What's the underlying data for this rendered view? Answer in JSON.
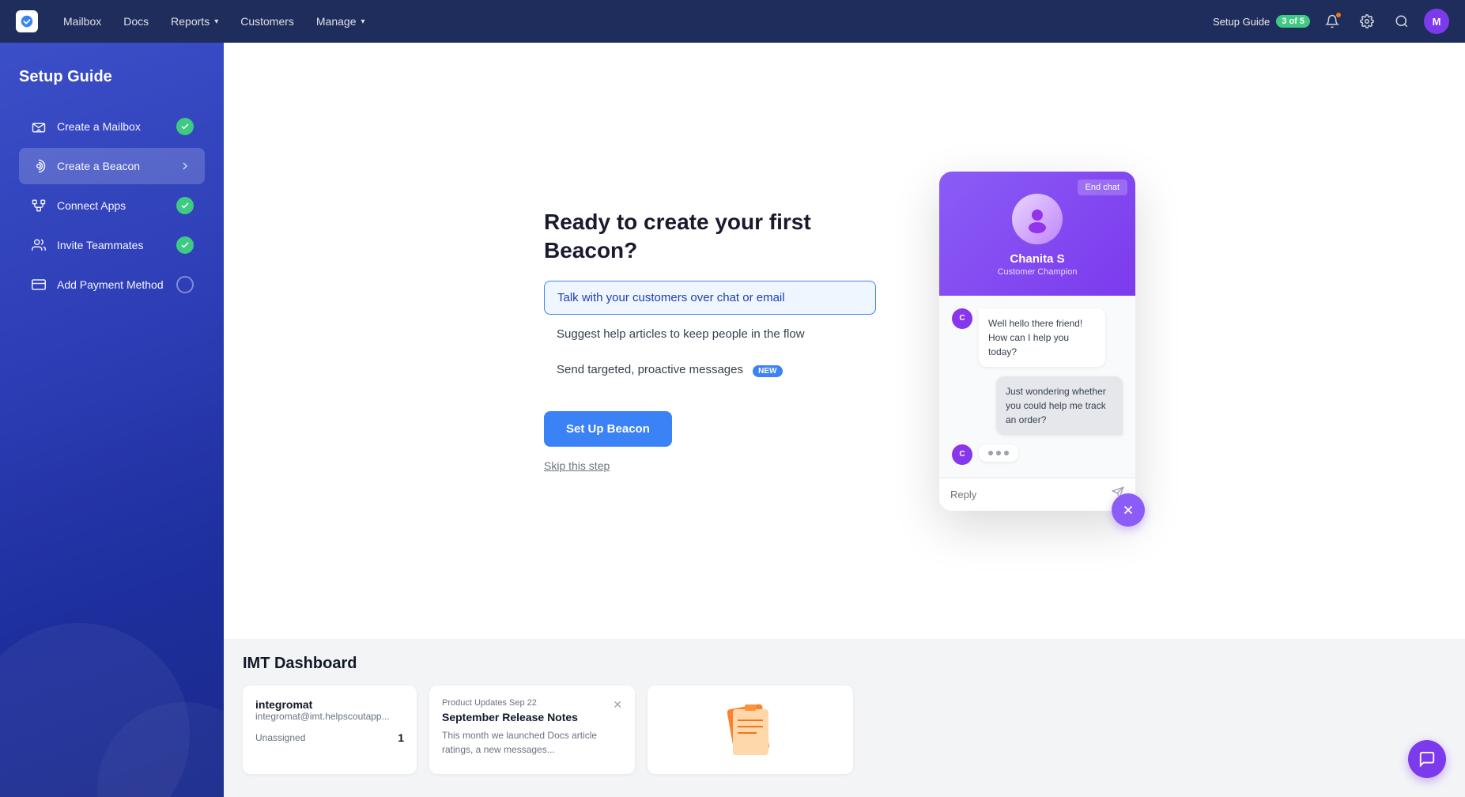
{
  "topnav": {
    "links": [
      {
        "label": "Mailbox",
        "id": "mailbox"
      },
      {
        "label": "Docs",
        "id": "docs"
      },
      {
        "label": "Reports",
        "id": "reports",
        "has_dropdown": true
      },
      {
        "label": "Customers",
        "id": "customers"
      },
      {
        "label": "Manage",
        "id": "manage",
        "has_dropdown": true
      }
    ],
    "setup_guide_label": "Setup Guide",
    "setup_guide_count": "3 of 5",
    "user_initials": "M"
  },
  "sidebar": {
    "title": "Setup Guide",
    "items": [
      {
        "id": "create-mailbox",
        "label": "Create a Mailbox",
        "status": "done"
      },
      {
        "id": "create-beacon",
        "label": "Create a Beacon",
        "status": "active"
      },
      {
        "id": "connect-apps",
        "label": "Connect Apps",
        "status": "done"
      },
      {
        "id": "invite-teammates",
        "label": "Invite Teammates",
        "status": "done"
      },
      {
        "id": "add-payment",
        "label": "Add Payment Method",
        "status": "todo"
      }
    ]
  },
  "setup": {
    "heading": "Ready to create your first Beacon?",
    "features": [
      {
        "label": "Talk with your customers over chat or email",
        "selected": true
      },
      {
        "label": "Suggest help articles to keep people in the flow",
        "selected": false
      },
      {
        "label": "Send targeted, proactive messages",
        "selected": false,
        "badge": "New"
      }
    ],
    "cta_label": "Set Up Beacon",
    "skip_label": "Skip this step"
  },
  "beacon_widget": {
    "end_chat_label": "End chat",
    "agent_name": "Chanita S",
    "agent_role": "Customer Champion",
    "agent_initials": "C",
    "messages": [
      {
        "from": "agent",
        "text": "Well hello there friend! How can I help you today?"
      },
      {
        "from": "user",
        "text": "Just wondering whether you could help me track an order?"
      },
      {
        "from": "agent",
        "text": "...",
        "typing": true
      }
    ],
    "reply_placeholder": "Reply"
  },
  "bottom": {
    "dashboard_title": "IMT Dashboard",
    "cards": [
      {
        "id": "integromat",
        "brand": "integromat",
        "email": "integromat@imt.helpscoutapp...",
        "label": "Unassigned",
        "count": "1"
      },
      {
        "id": "product-updates",
        "meta": "Product Updates  Sep 22",
        "title": "September Release Notes",
        "body": "This month we launched Docs article ratings, a new messages..."
      }
    ]
  }
}
